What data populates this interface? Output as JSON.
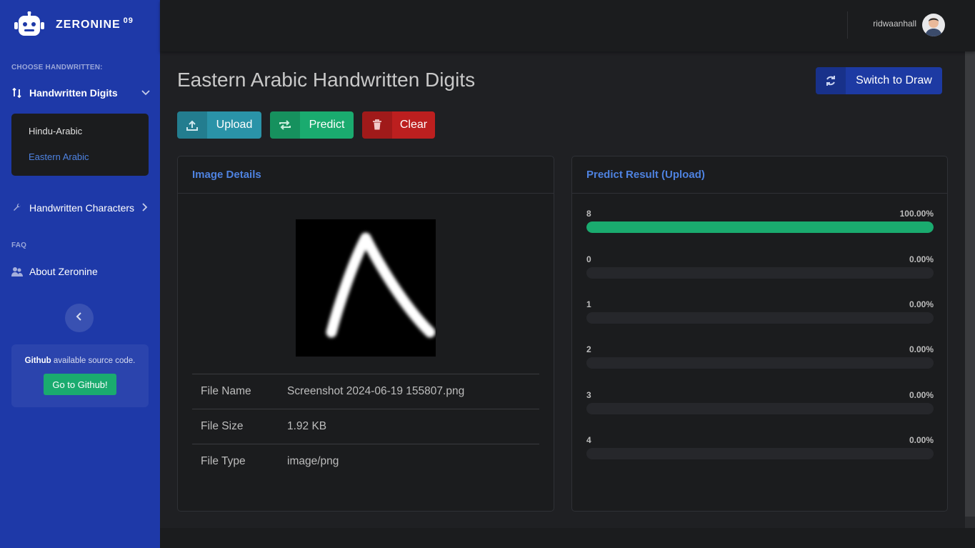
{
  "brand": {
    "name": "ZERONINE",
    "sup": "09"
  },
  "sidebar": {
    "heading_choose": "CHOOSE HANDWRITTEN:",
    "digits_label": "Handwritten Digits",
    "submenu": [
      "Hindu-Arabic",
      "Eastern Arabic"
    ],
    "characters_label": "Handwritten Characters",
    "heading_faq": "FAQ",
    "about_label": "About Zeronine",
    "github_bold": "Github",
    "github_text": " available source code.",
    "github_button": "Go to Github!"
  },
  "topbar": {
    "username": "ridwaanhall"
  },
  "page": {
    "title": "Eastern Arabic Handwritten Digits",
    "switch_label": "Switch to Draw",
    "upload_label": "Upload",
    "predict_label": "Predict",
    "clear_label": "Clear"
  },
  "image_details": {
    "title": "Image Details",
    "rows": [
      {
        "key": "File Name",
        "value": "Screenshot 2024-06-19 155807.png"
      },
      {
        "key": "File Size",
        "value": "1.92 KB"
      },
      {
        "key": "File Type",
        "value": "image/png"
      }
    ]
  },
  "predict_result": {
    "title": "Predict Result (Upload)",
    "rows": [
      {
        "label": "8",
        "pct": "100.00%",
        "value": 100
      },
      {
        "label": "0",
        "pct": "0.00%",
        "value": 0
      },
      {
        "label": "1",
        "pct": "0.00%",
        "value": 0
      },
      {
        "label": "2",
        "pct": "0.00%",
        "value": 0
      },
      {
        "label": "3",
        "pct": "0.00%",
        "value": 0
      },
      {
        "label": "4",
        "pct": "0.00%",
        "value": 0
      }
    ]
  },
  "colors": {
    "sidebar": "#1e39a8",
    "accent_link": "#4e82e0",
    "success": "#1aab6f",
    "info": "#2a93a8",
    "danger": "#bc1f1f"
  },
  "icons": [
    "robot-logo-icon",
    "sort-arrows-icon",
    "chevron-down-icon",
    "wrench-icon",
    "chevron-right-icon",
    "users-icon",
    "chevron-left-icon",
    "refresh-icon",
    "upload-icon",
    "exchange-icon",
    "trash-icon"
  ]
}
